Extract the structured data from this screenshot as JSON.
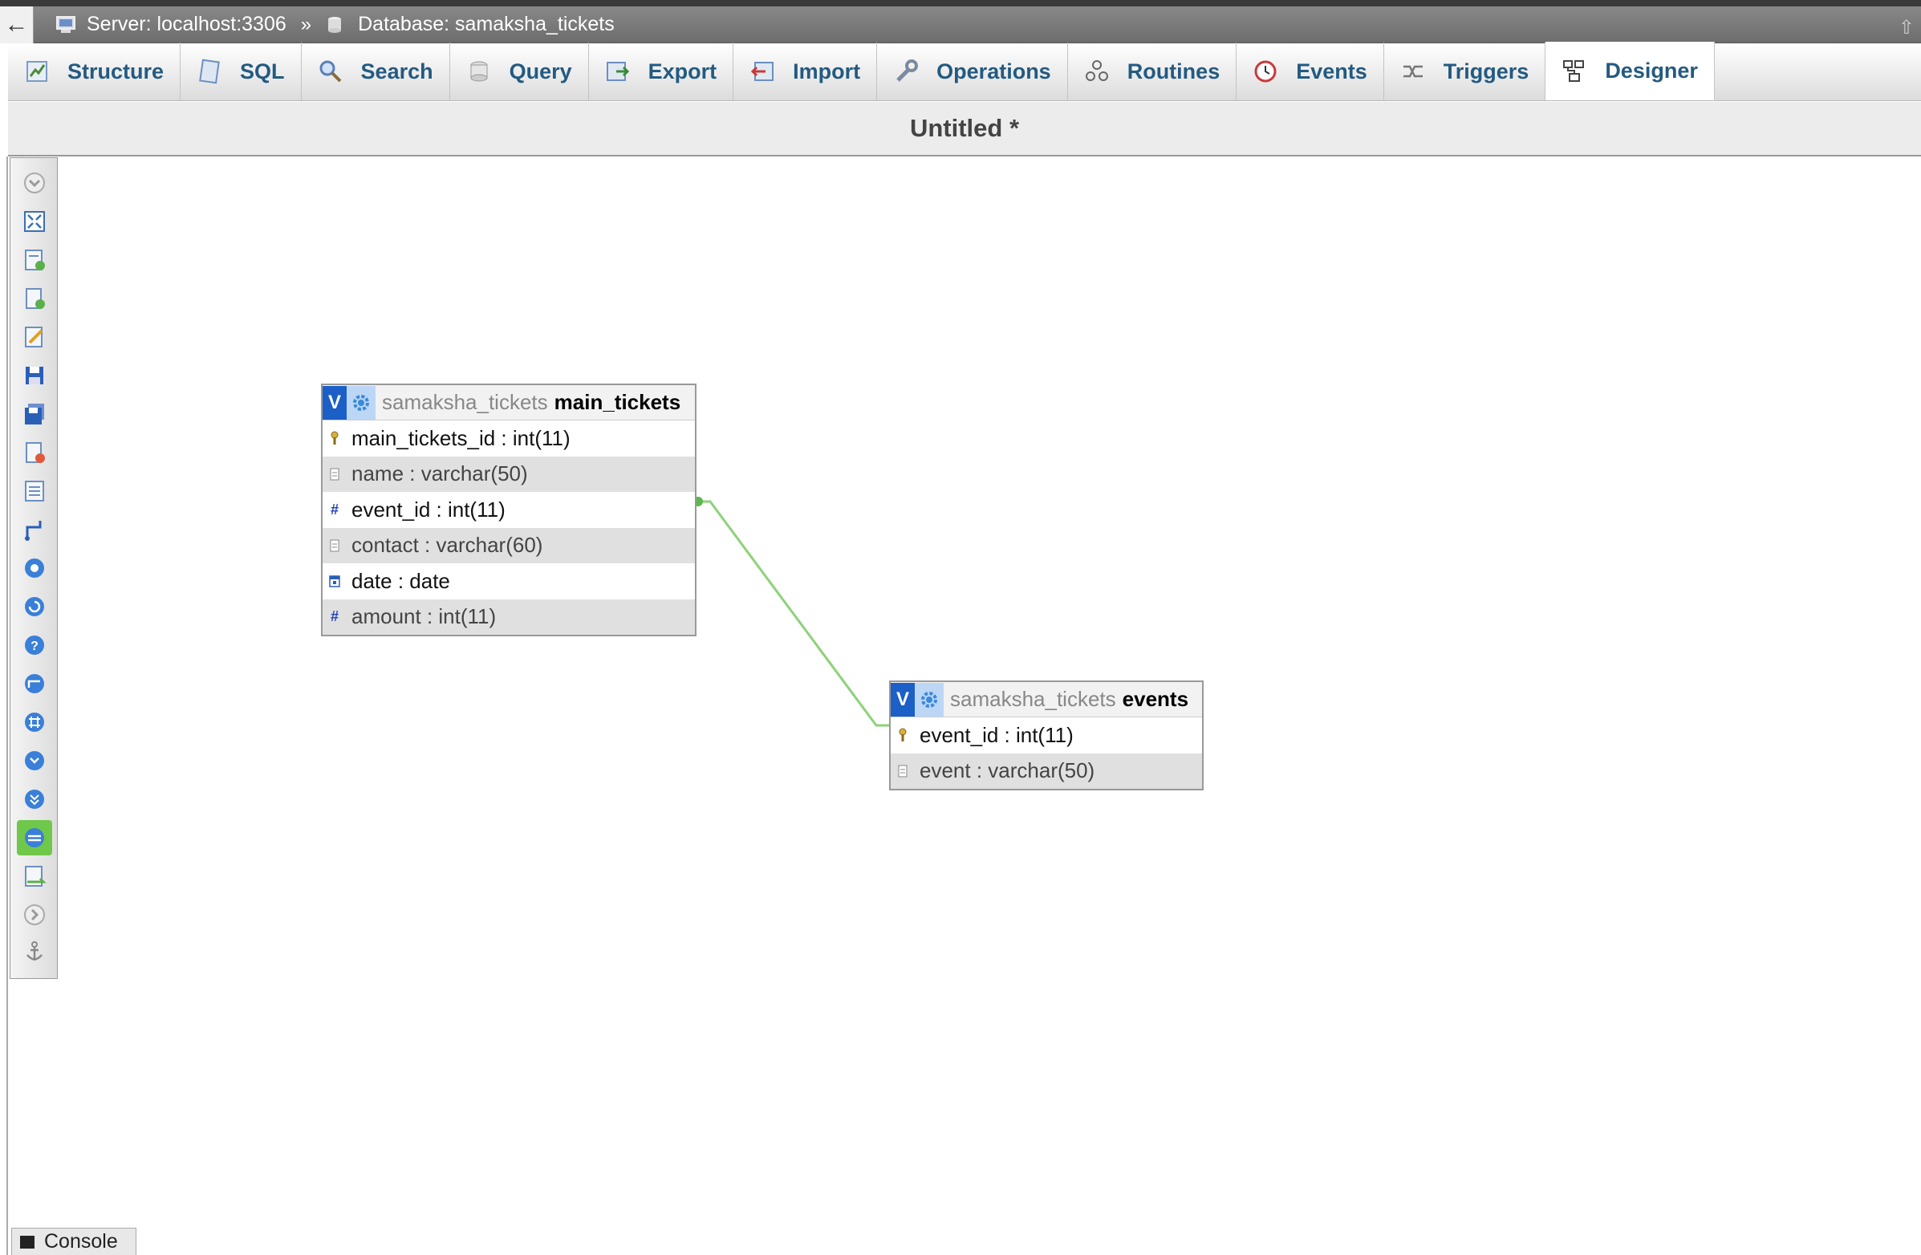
{
  "breadcrumb": {
    "server": "Server: localhost:3306",
    "separator": "»",
    "database": "Database: samaksha_tickets"
  },
  "tabs": [
    {
      "label": "Structure",
      "icon": "structure-icon"
    },
    {
      "label": "SQL",
      "icon": "sql-icon"
    },
    {
      "label": "Search",
      "icon": "search-icon"
    },
    {
      "label": "Query",
      "icon": "query-icon"
    },
    {
      "label": "Export",
      "icon": "export-icon"
    },
    {
      "label": "Import",
      "icon": "import-icon"
    },
    {
      "label": "Operations",
      "icon": "operations-icon"
    },
    {
      "label": "Routines",
      "icon": "routines-icon"
    },
    {
      "label": "Events",
      "icon": "events-icon"
    },
    {
      "label": "Triggers",
      "icon": "triggers-icon"
    },
    {
      "label": "Designer",
      "icon": "designer-icon",
      "active": true
    }
  ],
  "designer": {
    "title": "Untitled *"
  },
  "toolbar_icons": [
    "toggle-menu-icon",
    "fullscreen-icon",
    "add-tables-icon",
    "new-page-icon",
    "edit-page-icon",
    "save-icon",
    "save-as-icon",
    "delete-page-icon",
    "view-schema-icon",
    "create-relation-icon",
    "choose-display-icon",
    "reload-icon",
    "help-icon",
    "angular-links-icon",
    "snap-to-grid-icon",
    "small-big-all-icon",
    "toggle-small-big-icon",
    "toggle-relation-lines-icon",
    "export-schema-icon",
    "move-menu-icon",
    "pin-text-icon"
  ],
  "tables": [
    {
      "db": "samaksha_tickets",
      "name": "main_tickets",
      "columns": [
        {
          "text": "main_tickets_id : int(11)",
          "icon": "primary-key-icon"
        },
        {
          "text": "name : varchar(50)",
          "icon": "text-column-icon"
        },
        {
          "text": "event_id : int(11)",
          "icon": "numeric-column-icon"
        },
        {
          "text": "contact : varchar(60)",
          "icon": "text-column-icon"
        },
        {
          "text": "date : date",
          "icon": "date-column-icon"
        },
        {
          "text": "amount : int(11)",
          "icon": "numeric-column-icon"
        }
      ]
    },
    {
      "db": "samaksha_tickets",
      "name": "events",
      "columns": [
        {
          "text": "event_id : int(11)",
          "icon": "primary-key-icon"
        },
        {
          "text": "event : varchar(50)",
          "icon": "text-column-icon"
        }
      ]
    }
  ],
  "relation": {
    "from": "main_tickets.event_id",
    "to": "events.event_id",
    "color": "#8ed17a"
  },
  "console": {
    "label": "Console"
  },
  "colors": {
    "tab_text": "#235a81",
    "v_button": "#1b5fc7",
    "active_tool": "#6fc84a"
  }
}
